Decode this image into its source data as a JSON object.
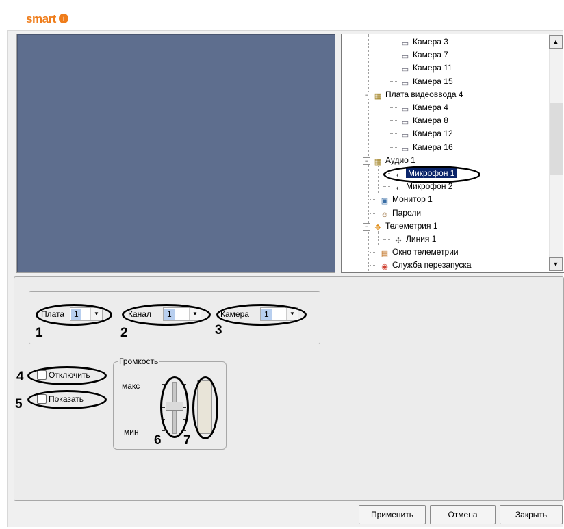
{
  "app": {
    "logo_text": "smart",
    "logo_mark": "i"
  },
  "tree": {
    "items": [
      {
        "label": "Камера 3",
        "icon": "camera-icon"
      },
      {
        "label": "Камера 7",
        "icon": "camera-icon"
      },
      {
        "label": "Камера 11",
        "icon": "camera-icon"
      },
      {
        "label": "Камера 15",
        "icon": "camera-icon"
      },
      {
        "label": "Плата видеоввода 4",
        "icon": "board-icon",
        "expander": "−"
      },
      {
        "label": "Камера 4",
        "icon": "camera-icon"
      },
      {
        "label": "Камера 8",
        "icon": "camera-icon"
      },
      {
        "label": "Камера 12",
        "icon": "camera-icon"
      },
      {
        "label": "Камера 16",
        "icon": "camera-icon"
      },
      {
        "label": "Аудио 1",
        "icon": "audio-board-icon",
        "expander": "−"
      },
      {
        "label": "Микрофон 1",
        "icon": "microphone-icon",
        "selected": true
      },
      {
        "label": "Микрофон 2",
        "icon": "microphone-icon"
      },
      {
        "label": "Монитор 1",
        "icon": "monitor-icon"
      },
      {
        "label": "Пароли",
        "icon": "users-icon"
      },
      {
        "label": "Телеметрия 1",
        "icon": "telemetry-icon",
        "expander": "−"
      },
      {
        "label": "Линия 1",
        "icon": "ptz-line-icon"
      },
      {
        "label": "Окно телеметрии",
        "icon": "telemetry-window-icon"
      },
      {
        "label": "Служба перезапуска",
        "icon": "restart-service-icon"
      }
    ],
    "scroll_up": "▲",
    "scroll_down": "▼"
  },
  "settings": {
    "board": {
      "label": "Плата",
      "value": "1"
    },
    "channel": {
      "label": "Канал",
      "value": "1"
    },
    "camera": {
      "label": "Камера",
      "value": "1"
    },
    "disable_label": "Отключить",
    "disable_checked": false,
    "show_label": "Показать",
    "show_checked": false,
    "volume": {
      "title": "Громкость",
      "max_label": "макс",
      "min_label": "мин"
    }
  },
  "callouts": [
    "1",
    "2",
    "3",
    "4",
    "5",
    "6",
    "7"
  ],
  "buttons": {
    "apply": "Применить",
    "cancel": "Отмена",
    "close": "Закрыть"
  },
  "colors": {
    "video_bg": "#5e6e8e",
    "logo": "#ef7d1b",
    "selection": "#0a246a"
  }
}
